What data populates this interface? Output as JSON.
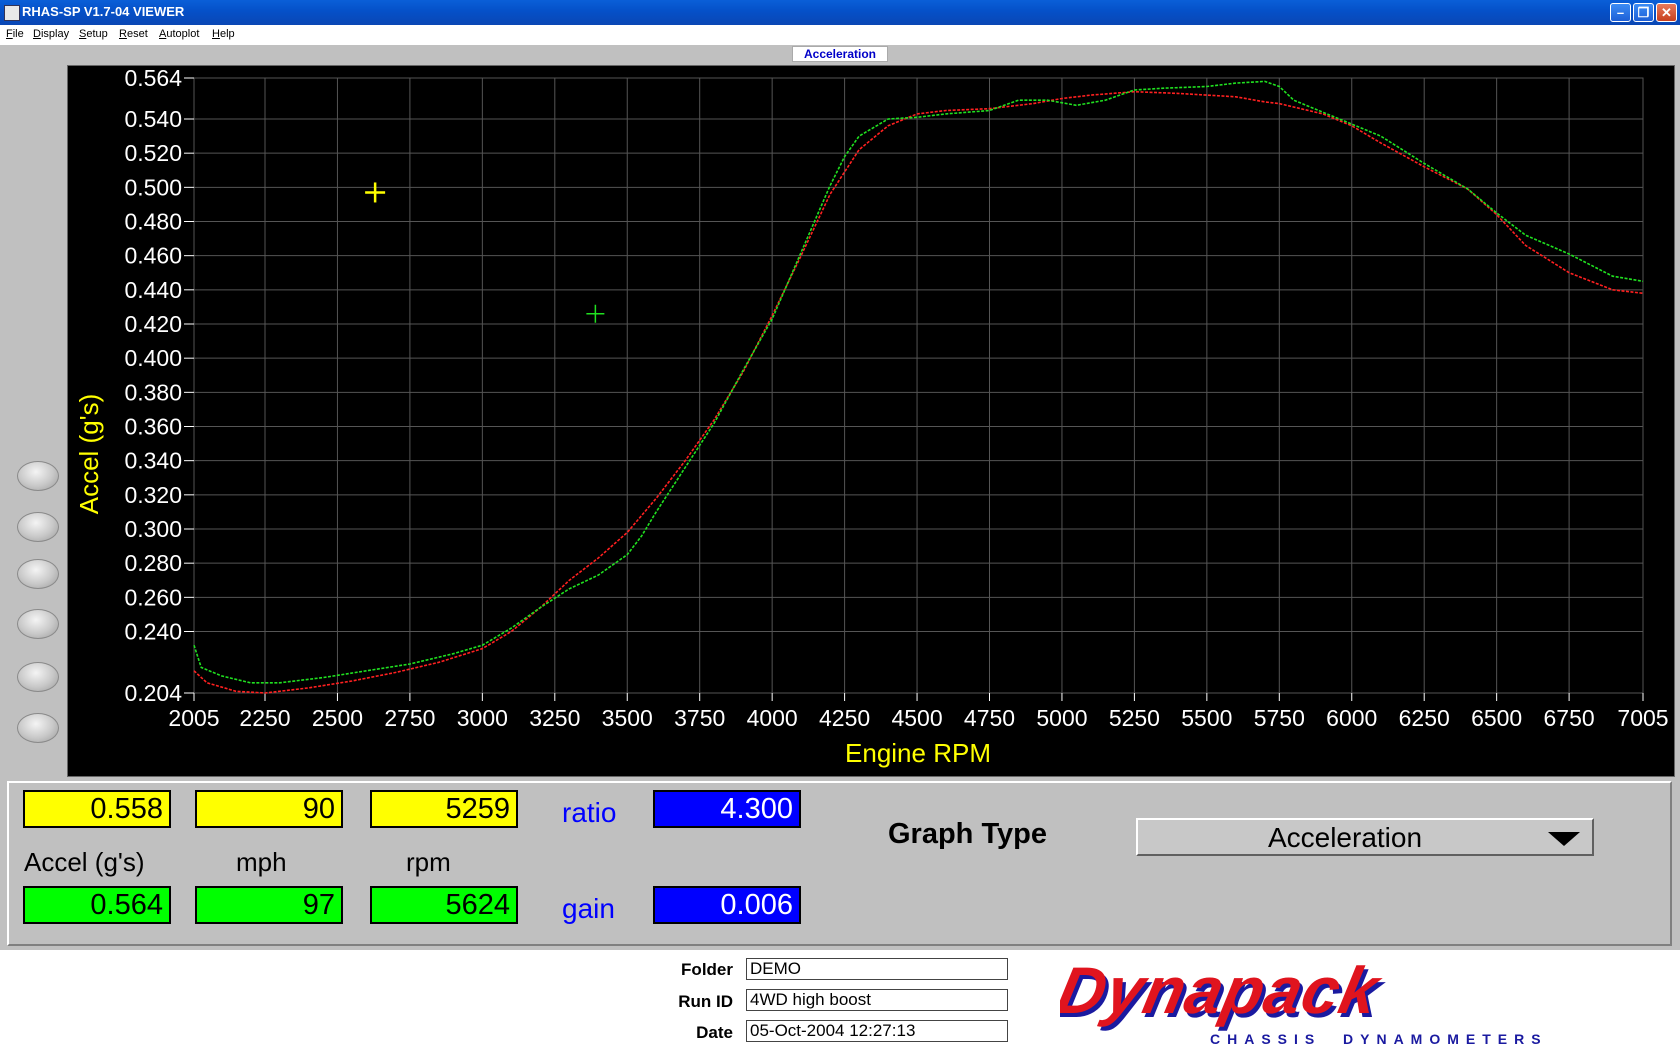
{
  "window": {
    "title": "RHAS-SP V1.7-04  VIEWER",
    "controls": [
      "minimize-icon",
      "restore-icon",
      "close-icon"
    ]
  },
  "menu": [
    "File",
    "Display",
    "Setup",
    "Reset",
    "Autoplot",
    "Help"
  ],
  "graph": {
    "title": "Acceleration"
  },
  "readouts": {
    "yellow": {
      "accel": "0.558",
      "mph": "90",
      "rpm": "5259"
    },
    "green": {
      "accel": "0.564",
      "mph": "97",
      "rpm": "5624"
    },
    "labels": {
      "accel": "Accel (g's)",
      "mph": "mph",
      "rpm": "rpm"
    },
    "ratio_label": "ratio",
    "ratio_value": "4.300",
    "gain_label": "gain",
    "gain_value": "0.006"
  },
  "graph_type": {
    "label": "Graph Type",
    "selected": "Acceleration"
  },
  "run_info": {
    "folder_label": "Folder",
    "folder": "DEMO",
    "run_id_label": "Run ID",
    "run_id": "4WD high boost",
    "date_label": "Date",
    "date": "05-Oct-2004  12:27:13"
  },
  "logo": {
    "brand": "Dynapack",
    "tagline": "CHASSIS  DYNAMOMETERS"
  },
  "colors": {
    "red_series": "#ff2020",
    "green_series": "#20e020",
    "axis_label": "#ffff00",
    "grid": "#555555"
  },
  "chart_data": {
    "type": "line",
    "title": "",
    "xlabel": "Engine RPM",
    "ylabel": "Accel (g's)",
    "xlim": [
      2005,
      7005
    ],
    "ylim": [
      0.204,
      0.564
    ],
    "x_ticks": [
      "2005",
      "2250",
      "2500",
      "2750",
      "3000",
      "3250",
      "3500",
      "3750",
      "4000",
      "4250",
      "4500",
      "4750",
      "5000",
      "5250",
      "5500",
      "5750",
      "6000",
      "6250",
      "6500",
      "6750",
      "7005"
    ],
    "y_ticks": [
      "0.564",
      "0.540",
      "0.520",
      "0.500",
      "0.480",
      "0.460",
      "0.440",
      "0.420",
      "0.400",
      "0.380",
      "0.360",
      "0.340",
      "0.320",
      "0.300",
      "0.280",
      "0.260",
      "0.240",
      "0.204"
    ],
    "grid": true,
    "cursors": [
      {
        "series": "yellow",
        "rpm": 2630,
        "accel": 0.497
      },
      {
        "series": "green",
        "rpm": 3390,
        "accel": 0.426
      }
    ],
    "series": [
      {
        "color": "red",
        "x": [
          2005,
          2050,
          2150,
          2250,
          2400,
          2550,
          2700,
          2850,
          3000,
          3100,
          3200,
          3300,
          3400,
          3500,
          3600,
          3700,
          3800,
          3900,
          4000,
          4100,
          4200,
          4300,
          4400,
          4500,
          4600,
          4750,
          4900,
          5000,
          5100,
          5250,
          5400,
          5500,
          5600,
          5700,
          5750,
          5900,
          6000,
          6100,
          6250,
          6400,
          6500,
          6600,
          6750,
          6900,
          7005
        ],
        "y": [
          0.217,
          0.21,
          0.205,
          0.204,
          0.207,
          0.211,
          0.216,
          0.222,
          0.23,
          0.24,
          0.254,
          0.27,
          0.283,
          0.298,
          0.318,
          0.34,
          0.364,
          0.392,
          0.425,
          0.46,
          0.496,
          0.522,
          0.536,
          0.543,
          0.545,
          0.546,
          0.549,
          0.552,
          0.554,
          0.556,
          0.555,
          0.554,
          0.553,
          0.55,
          0.549,
          0.543,
          0.536,
          0.526,
          0.512,
          0.499,
          0.484,
          0.466,
          0.45,
          0.44,
          0.438
        ]
      },
      {
        "color": "green",
        "x": [
          2005,
          2030,
          2100,
          2200,
          2300,
          2450,
          2600,
          2750,
          2900,
          3000,
          3100,
          3200,
          3300,
          3400,
          3500,
          3550,
          3600,
          3700,
          3800,
          3900,
          4000,
          4100,
          4200,
          4250,
          4300,
          4400,
          4500,
          4600,
          4750,
          4850,
          4950,
          5050,
          5150,
          5250,
          5350,
          5500,
          5600,
          5700,
          5750,
          5800,
          5900,
          6000,
          6100,
          6250,
          6400,
          6500,
          6600,
          6750,
          6900,
          7005
        ],
        "y": [
          0.232,
          0.219,
          0.214,
          0.21,
          0.21,
          0.213,
          0.217,
          0.221,
          0.227,
          0.232,
          0.242,
          0.254,
          0.265,
          0.273,
          0.285,
          0.296,
          0.31,
          0.336,
          0.362,
          0.393,
          0.423,
          0.462,
          0.501,
          0.518,
          0.53,
          0.54,
          0.541,
          0.543,
          0.545,
          0.551,
          0.551,
          0.548,
          0.551,
          0.557,
          0.558,
          0.559,
          0.561,
          0.562,
          0.559,
          0.551,
          0.544,
          0.537,
          0.53,
          0.514,
          0.499,
          0.485,
          0.472,
          0.461,
          0.448,
          0.445
        ]
      }
    ]
  }
}
